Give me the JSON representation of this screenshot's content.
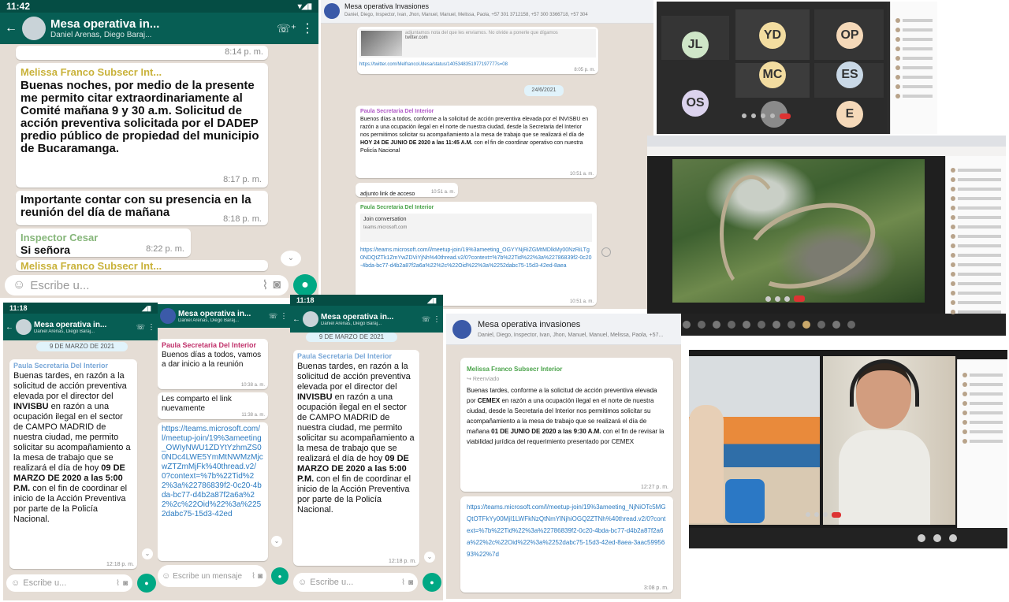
{
  "p1": {
    "time": "11:42",
    "title": "Mesa operativa in...",
    "subtitle": "Daniel Arenas, Diego Baraj...",
    "time_top": "8:14 p. m.",
    "msg1_sender": "Melissa Franco Subsecr Int...",
    "msg1_text": "Buenas noches, por medio de la presente me permito citar extraordinariamente al Comité mañana 9 y 30 a.m. Solicitud de acción preventiva solicitada por el DADEP predio público de propiedad del municipio de Bucaramanga.",
    "msg1_time": "8:17 p. m.",
    "msg2_text": "Importante contar con su presencia en la reunión del día de mañana",
    "msg2_time": "8:18 p. m.",
    "msg3_sender": "Inspector Cesar",
    "msg3_text": "Si señora",
    "msg3_time": "8:22 p. m.",
    "msg4_sender": "Melissa Franco Subsecr Int...",
    "input_placeholder": "Escribe u..."
  },
  "p2": {
    "title": "Mesa operativa Invasiones",
    "participants": "Daniel, Diego, Inspector, Ivan, Jhon, Manuel, Manuel, Melissa, Paola, +57 301 3712158, +57 300 3366718, +57 304",
    "link_preview_text": "adjuntamos nota del que les enviamos. No olvide a ponerle que dígamos",
    "link_domain": "twitter.com",
    "link_url": "https://twitter.com/MelfrancoUdesa/status/1405348351977197777s=08",
    "link_time": "8:05 p. m.",
    "date_chip": "24/6/2021",
    "msg1_sender": "Paula Secretaria Del Interior",
    "msg1_text_a": "Buenos días a todos, conforme a la solicitud de acción preventiva elevada por el INVISBU en razón a una ocupación ilegal en el norte de nuestra ciudad, desde la Secretaria del Interior nos permitimos solicitar su acompañamiento a la mesa de trabajo que se realizará el día de ",
    "msg1_bold": "HOY 24 DE JUNIO DE 2020 a las 11:45 A.M.",
    "msg1_text_b": " con el fin de coordinar operativo con nuestra Policía Nacional",
    "msg1_time": "10:51 a. m.",
    "msg2_text": "adjunto link de acceso",
    "msg2_time": "10:51 a. m.",
    "msg3_sender": "Paula Secretaria Del Interior",
    "join_title": "Join conversation",
    "join_domain": "teams.microsoft.com",
    "msg3_link": "https://teams.microsoft.com/l/meetup-join/19%3ameeting_OGYYNjRiZGMtMDlkMy00NzRiLTg0NDQtZTk1ZmYwZDViYjNh%40thread.v2/0?context=%7b%22Tid%22%3a%22786839f2-0c20-4bda-bc77-d4b2a87f2a6a%22%2c%22Oid%22%3a%2252dabc75-15d3-42ed-8aea",
    "msg3_time": "10:51 a. m."
  },
  "p3": {
    "participants": [
      "JL",
      "YD",
      "OP",
      "MC",
      "ES",
      "OS",
      "E"
    ],
    "colors": {
      "JL": "#cfe6c8",
      "YD": "#f2dca0",
      "OP": "#f5d9b9",
      "MC": "#f2dca0",
      "ES": "#c9d8e6",
      "OS": "#dcd3ee",
      "E": "#f5d9b9"
    }
  },
  "p4": {
    "label": "aerial-video-meeting"
  },
  "p5": {
    "time": "11:18",
    "title": "Mesa operativa in...",
    "subtitle": "Daniel Arenas, Diego Baraj...",
    "date_chip": "9 DE MARZO DE 2021",
    "sender": "Paula Secretaria Del Interior",
    "text_a": "Buenas tardes, en razón a la solicitud de acción preventiva elevada por el director del ",
    "bold1": "INVISBU",
    "text_b": " en razón a una ocupación ilegal en el sector de CAMPO MADRID de nuestra ciudad, me permito solicitar su acompañamiento a la mesa de trabajo que se realizará el día de hoy ",
    "bold2": "09 DE MARZO DE 2020 a las 5:00 P.M.",
    "text_c": " con el fin de coordinar el inicio de la Acción Preventiva por parte de la Policía Nacional.",
    "time_msg": "12:18 p. m.",
    "input_placeholder": "Escribe u..."
  },
  "p6": {
    "title": "Mesa operativa in...",
    "subtitle": "Daniel Arenas, Diego Baraj...",
    "sender": "Paula Secretaria Del Interior",
    "msg1_text": "Buenos días a todos, vamos a dar inicio a la reunión",
    "msg1_time": "10:38 a. m.",
    "msg2_text": "Les comparto el link nuevamente",
    "msg2_time": "11:38 a. m.",
    "link": "https://teams.microsoft.com/l/meetup-join/19%3ameeting_OWIyNWU1ZDYtYzhmZS00NDc4LWE5YmMtNWMzMjcwZTZmMjFk%40thread.v2/0?context=%7b%22Tid%22%3a%22786839f2-0c20-4bda-bc77-d4b2a87f2a6a%22%2c%22Oid%22%3a%2252dabc75-15d3-42ed",
    "input_placeholder": "Escribe un mensaje"
  },
  "p7": {
    "time": "11:18",
    "title": "Mesa operativa in...",
    "subtitle": "Daniel Arenas, Diego Baraj...",
    "date_chip": "9 DE MARZO DE 2021",
    "sender": "Paula Secretaria Del Interior",
    "text_a": "Buenas tardes, en razón a la solicitud de acción preventiva elevada por el director del ",
    "bold1": "INVISBU",
    "text_b": " en razón a una ocupación ilegal en el sector de CAMPO MADRID de nuestra ciudad, me permito solicitar su acompañamiento a la mesa de trabajo que se realizará el día de hoy ",
    "bold2": "09 DE MARZO DE 2020 a las 5:00 P.M.",
    "text_c": " con el fin de coordinar el inicio de la Acción Preventiva por parte de la Policía Nacional.",
    "time_msg": "12:18 p. m.",
    "input_placeholder": "Escribe u..."
  },
  "p8": {
    "title": "Mesa operativa invasiones",
    "participants": "Daniel, Diego, Inspector, Ivan, Jhon, Manuel, Manuel, Melissa, Paola, +57...",
    "sender": "Melissa Franco Subsecr Interior",
    "forwarded": "Reenviado",
    "text_a": "Buenas tardes, conforme a la solicitud de acción preventiva elevada por ",
    "bold1": "CEMEX",
    "text_b": " en razón a una ocupación ilegal en el norte de nuestra ciudad, desde la Secretaria del Interior nos permitimos solicitar su acompañamiento a la mesa de trabajo que se realizará el día de mañana ",
    "bold2": "01 DE JUNIO DE 2020 a las 9:30 A.M.",
    "text_c": " con el fin de revisar la viabilidad jurídica del requerimiento presentado por CEMEX",
    "time1": "12:27 p. m.",
    "link": "https://teams.microsoft.com/l/meetup-join/19%3ameeting_NjNiOTc5MGQtOTFkYy00MjI1LWFkNzQtNmYlNjhiOGQ2ZTNh%40thread.v2/0?context=%7b%22Tid%22%3a%22786839f2-0c20-4bda-bc77-d4b2a87f2a6a%22%2c%22Oid%22%3a%2252dabc75-15d3-42ed-8aea-3aac5995693%22%7d",
    "time2": "3:08 p. m."
  },
  "p9": {
    "label": "video-call-meeting"
  }
}
